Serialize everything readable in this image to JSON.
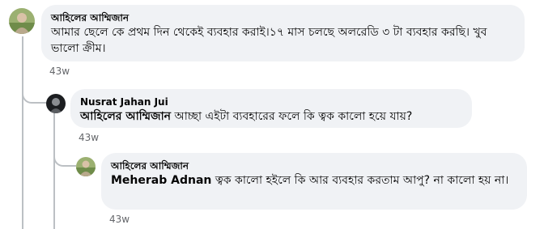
{
  "comments": [
    {
      "author": "আহিলের আম্মিজান",
      "text": "আমার ছেলে কে প্রথম দিন থেকেই ব্যবহার করাই।১৭ মাস চলছে অলরেডি ৩ টা ব্যবহার করছি। খুব ভালো ক্রীম।",
      "time": "43w"
    },
    {
      "author": "Nusrat Jahan Jui",
      "mention": "আহিলের আম্মিজান",
      "text": "আচ্ছা এইটা ব্যবহারের ফলে কি ত্বক কালো হয়ে যায়?",
      "time": "43w"
    },
    {
      "author": "আহিলের আম্মিজান",
      "mention": "Meherab Adnan",
      "text": "ত্বক কালো হইলে কি আর ব্যবহার করতাম আপু? না কালো হয় না।",
      "time": "43w"
    }
  ],
  "colors": {
    "bubble": "#f0f2f5",
    "secondary_text": "#65676b",
    "thread_line": "#bcc0c4"
  }
}
